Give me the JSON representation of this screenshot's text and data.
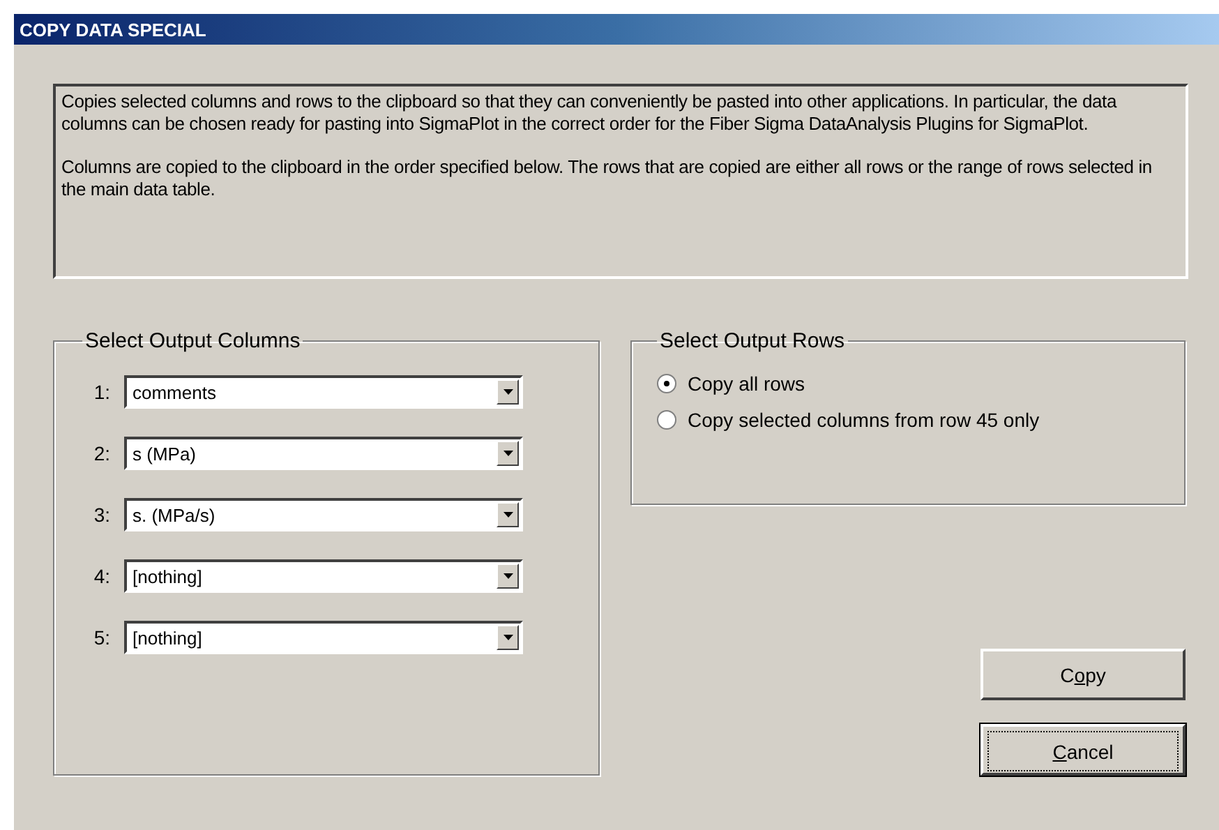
{
  "window": {
    "title": "COPY DATA SPECIAL"
  },
  "description": [
    "Copies selected columns and rows to the clipboard so that they can conveniently be pasted into other applications. In particular, the data columns can be chosen ready for pasting into SigmaPlot in the correct order for the Fiber Sigma DataAnalysis Plugins for SigmaPlot.",
    "Columns are copied to the clipboard in the order specified below. The rows that are copied are either all rows or the range of rows selected in the main data table."
  ],
  "output_columns": {
    "title": "Select Output Columns",
    "rows": [
      {
        "label": "1:",
        "value": "comments"
      },
      {
        "label": "2:",
        "value": "s (MPa)"
      },
      {
        "label": "3:",
        "value": "s. (MPa/s)"
      },
      {
        "label": "4:",
        "value": "[nothing]"
      },
      {
        "label": "5:",
        "value": "[nothing]"
      }
    ]
  },
  "output_rows": {
    "title": "Select Output Rows",
    "options": [
      {
        "label": "Copy all rows",
        "selected": true
      },
      {
        "label": "Copy selected columns from row 45 only",
        "selected": false
      }
    ]
  },
  "buttons": [
    {
      "before": "C",
      "key": "o",
      "after": "py",
      "focused": false
    },
    {
      "key": "C",
      "after": "ancel",
      "focused": true
    }
  ]
}
